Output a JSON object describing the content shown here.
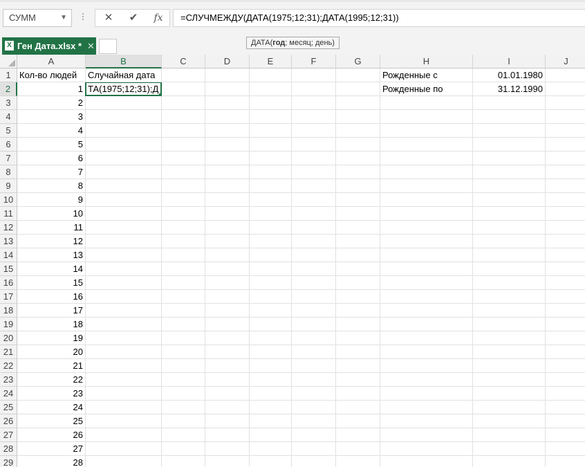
{
  "formula_bar": {
    "name_box": "СУММ",
    "cancel_glyph": "✕",
    "enter_glyph": "✔",
    "fx_glyph": "fx",
    "formula": "=СЛУЧМЕЖДУ(ДАТА(1975;12;31);ДАТА(1995;12;31))"
  },
  "tooltip": {
    "func": "ДАТА(",
    "bold_arg": "год",
    "rest": "; месяц; день)"
  },
  "workbook_tab": {
    "title": "Ген Дата.xlsx *",
    "close": "✕",
    "icon": "excel-icon"
  },
  "columns": [
    "A",
    "B",
    "C",
    "D",
    "E",
    "F",
    "G",
    "H",
    "I",
    "J"
  ],
  "rows": [
    "1",
    "2",
    "3",
    "4",
    "5",
    "6",
    "7",
    "8",
    "9",
    "10",
    "11",
    "12",
    "13",
    "14",
    "15",
    "16",
    "17",
    "18",
    "19",
    "20",
    "21",
    "22",
    "23",
    "24",
    "25",
    "26",
    "27",
    "28",
    "29"
  ],
  "cells": {
    "A1": "Кол-во людей",
    "B1": "Случайная дата",
    "H1": "Рожденные с",
    "I1": "01.01.1980",
    "H2": "Рожденные по",
    "I2": "31.12.1990",
    "B2": "ТА(1975;12;31);Д"
  },
  "column_a_values": [
    "1",
    "2",
    "3",
    "4",
    "5",
    "6",
    "7",
    "8",
    "9",
    "10",
    "11",
    "12",
    "13",
    "14",
    "15",
    "16",
    "17",
    "18",
    "19",
    "20",
    "21",
    "22",
    "23",
    "24",
    "25",
    "26",
    "27",
    "28"
  ],
  "colors": {
    "accent": "#217346"
  }
}
